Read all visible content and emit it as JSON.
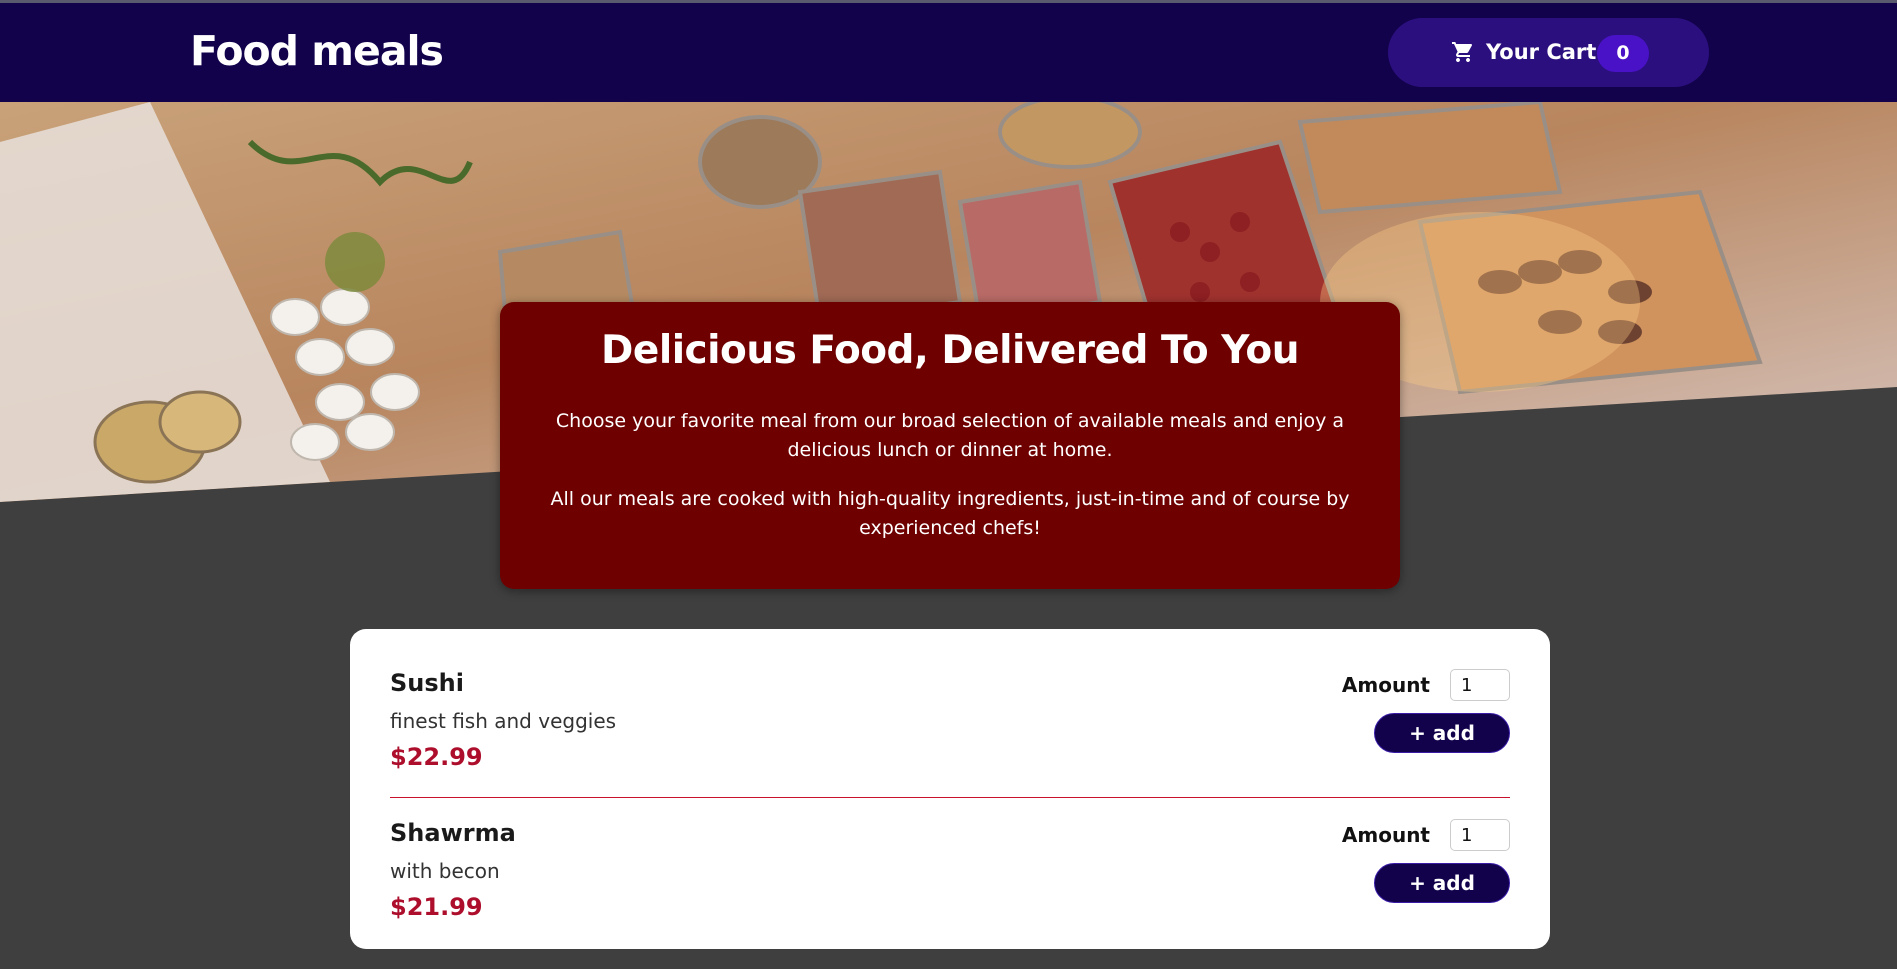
{
  "header": {
    "brand": "Food meals",
    "cart_label": "Your Cart",
    "cart_count": "0",
    "cart_icon": "shopping-cart-icon"
  },
  "intro": {
    "title": "Delicious Food, Delivered To You",
    "paragraph1": "Choose your favorite meal from our broad selection of available meals and enjoy a delicious lunch or dinner at home.",
    "paragraph2": "All our meals are cooked with high-quality ingredients, just-in-time and of course by experienced chefs!"
  },
  "meals": [
    {
      "name": "Sushi",
      "description": "finest fish and veggies",
      "price": "$22.99",
      "amount_label": "Amount",
      "amount_value": "1",
      "add_label": "+ add"
    },
    {
      "name": "Shawrma",
      "description": "with becon",
      "price": "$21.99",
      "amount_label": "Amount",
      "amount_value": "1",
      "add_label": "+ add"
    }
  ],
  "colors": {
    "header_bg": "#12024c",
    "cart_bg": "#2c0f7f",
    "badge_bg": "#4a12c7",
    "intro_bg": "#6e0000",
    "price": "#ad0e2c",
    "page_bg": "#3f3f3f"
  }
}
